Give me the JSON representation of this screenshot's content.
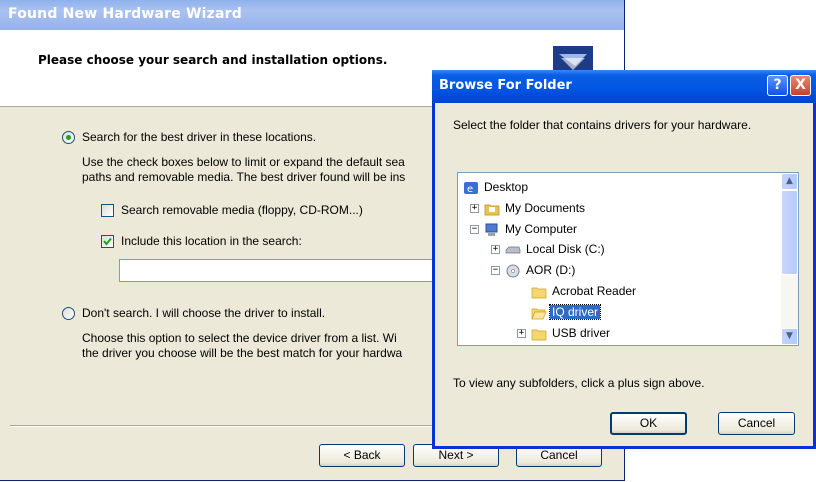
{
  "wizard": {
    "title": "Found New Hardware Wizard",
    "header": "Please choose your search and installation options.",
    "option_search": "Search for the best driver in these locations.",
    "desc_line1": "Use the check boxes below to limit or expand the default sea",
    "desc_line2": "paths and removable media. The best driver found will be ins",
    "check_removable": "Search removable media (floppy, CD-ROM...)",
    "check_include": "Include this location in the search:",
    "location_value": "",
    "option_dont": "Don't search. I will choose the driver to install.",
    "dont_line1": "Choose this option to select the device driver from a list.  Wi",
    "dont_line2": "the driver you choose will be the best match for your hardwa",
    "back_label": "< Back",
    "next_label": "Next >",
    "cancel_label": "Cancel",
    "search_selected": true,
    "removable_checked": false,
    "include_checked": true
  },
  "browse": {
    "title": "Browse For Folder",
    "help_label": "?",
    "close_label": "X",
    "instruction": "Select the folder that contains drivers for your hardware.",
    "tree": {
      "desktop": "Desktop",
      "my_documents": "My Documents",
      "my_computer": "My Computer",
      "local_disk": "Local Disk (C:)",
      "aor": "AOR (D:)",
      "acrobat": "Acrobat Reader",
      "iq_driver": "IQ driver",
      "usb_driver": "USB driver"
    },
    "footer": "To view any subfolders, click a plus sign above.",
    "ok_label": "OK",
    "cancel_label": "Cancel"
  },
  "colors": {
    "dialog_title": "#0054e3",
    "selection": "#316ac5",
    "face": "#ece9d8"
  }
}
